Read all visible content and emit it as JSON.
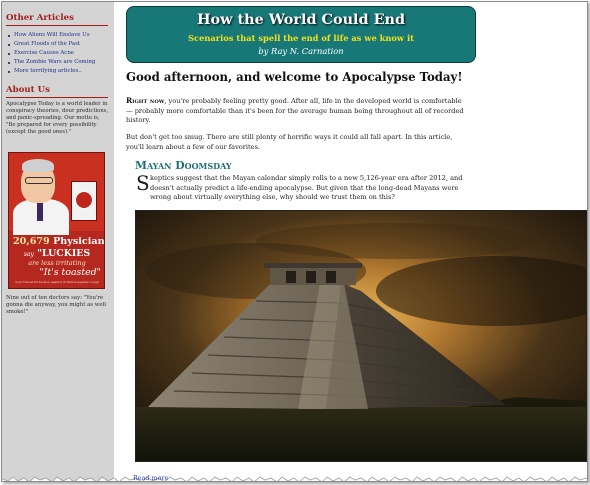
{
  "sidebar": {
    "other_articles_heading": "Other Articles",
    "articles": [
      "How Aliens Will Enslave Us",
      "Great Floods of the Past",
      "Exercise Causes Acne",
      "The Zombie Wars are Coming",
      "More terrifying articles.."
    ],
    "about_heading": "About Us",
    "about_text": "Apocalypse Today is a world leader in conspiracy theories, dour predictions, and panic-spreading. Our motto is, \"Be prepared for every possibility (except the good ones).\"",
    "ad": {
      "number": "20,679",
      "physicians": "Physicians",
      "say": "say",
      "luckies": "\"LUCKIES",
      "are_less_irritating": "are less irritating",
      "its_toasted": "\"It's toasted\"",
      "fine_print": "Your Throat Protection against irritation against cough"
    },
    "caption": "Nine out of ten doctors say: \"You're gonna die anyway, you might as well smoke!\""
  },
  "banner": {
    "title": "How the World Could End",
    "subtitle": "Scenarios that spell the end of life as we know it",
    "byline": "by Ray N. Carnation"
  },
  "main": {
    "headline": "Good afternoon, and welcome to Apocalypse Today!",
    "intro_lead": "Right now",
    "intro_rest": ", you're probably feeling pretty good. After all, life in the developed world is comfortable — probably more comfortable than it's been for the average human being throughout all of recorded history.",
    "intro2": "But don't get too smug. There are still plenty of horrific ways it could all fall apart. In this article, you'll learn about a few of our favorites.",
    "section_title": "Mayan Doomsday",
    "section_dropcap": "S",
    "section_text": "keptics suggest that the Mayan calendar simply rolls to a new 5,126-year era after 2012, and doesn't actually predict a life-ending apocalypse. But given that the long-dead Mayans were wrong about virtually everything else, why should we trust them on this?",
    "read_more": "Read more"
  },
  "colors": {
    "banner_bg": "#187878",
    "banner_subtitle": "#f2e21b",
    "heading_red": "#a31d1d",
    "section_teal": "#1c6f76",
    "link_blue": "#1f2f88",
    "sidebar_bg": "#d4d4d4"
  }
}
